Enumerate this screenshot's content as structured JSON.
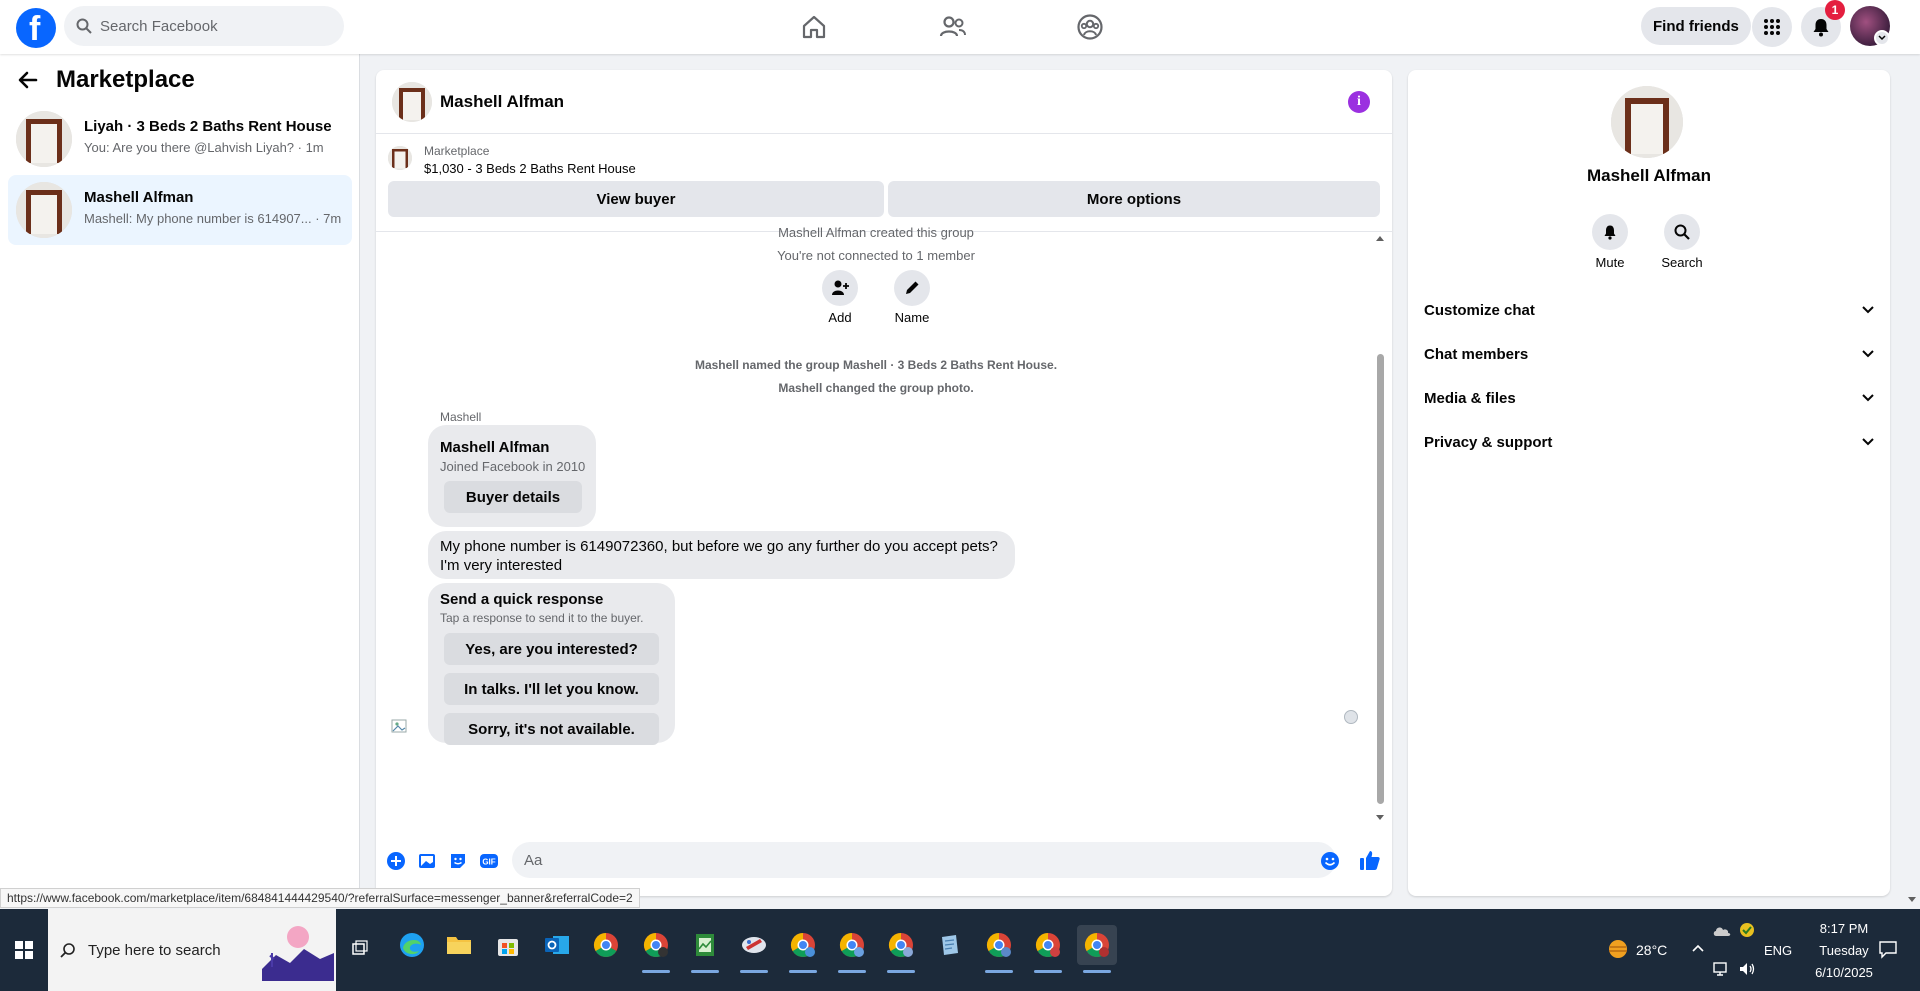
{
  "topbar": {
    "search_placeholder": "Search Facebook",
    "find_friends": "Find friends",
    "notification_count": "1",
    "brand_color": "#0866ff"
  },
  "sidebar": {
    "title": "Marketplace",
    "conversations": [
      {
        "name": "Liyah · 3 Beds 2 Baths Rent House",
        "preview": "You: Are you there @Lahvish Liyah? · 1m",
        "active": false
      },
      {
        "name": "Mashell Alfman",
        "preview": "Mashell: My phone number is 614907... · 7m",
        "active": true
      }
    ]
  },
  "chat": {
    "name": "Mashell Alfman",
    "listing_source": "Marketplace",
    "listing_title": "$1,030 - 3 Beds 2 Baths Rent House",
    "view_buyer": "View buyer",
    "more_options": "More options",
    "system": {
      "created": "Mashell Alfman created this group",
      "not_connected": "You're not connected to 1 member",
      "named": "Mashell named the group Mashell · 3 Beds 2 Baths Rent House.",
      "changed_photo": "Mashell changed the group photo."
    },
    "actions": {
      "add": "Add",
      "name": "Name"
    },
    "sender_label": "Mashell",
    "profile_card": {
      "name": "Mashell Alfman",
      "joined": "Joined Facebook in 2010",
      "button": "Buyer details"
    },
    "message": {
      "line1": "My phone number is 6149072360, but before we go any further do you accept pets?",
      "line2": "I'm very interested"
    },
    "quick_response": {
      "title": "Send a quick response",
      "subtitle": "Tap a response to send it to the buyer.",
      "options": [
        "Yes, are you interested?",
        "In talks. I'll let you know.",
        "Sorry, it's not available."
      ]
    },
    "input_placeholder": "Aa"
  },
  "info_panel": {
    "name": "Mashell Alfman",
    "actions": {
      "mute": "Mute",
      "search": "Search"
    },
    "sections": [
      "Customize chat",
      "Chat members",
      "Media & files",
      "Privacy & support"
    ]
  },
  "status_url": "https://www.facebook.com/marketplace/item/684841444429540/?referralSurface=messenger_banner&referralCode=2",
  "taskbar": {
    "search_placeholder": "Type here to search",
    "weather": "28°C",
    "language": "ENG",
    "time": "8:17 PM",
    "day": "Tuesday",
    "date": "6/10/2025"
  }
}
